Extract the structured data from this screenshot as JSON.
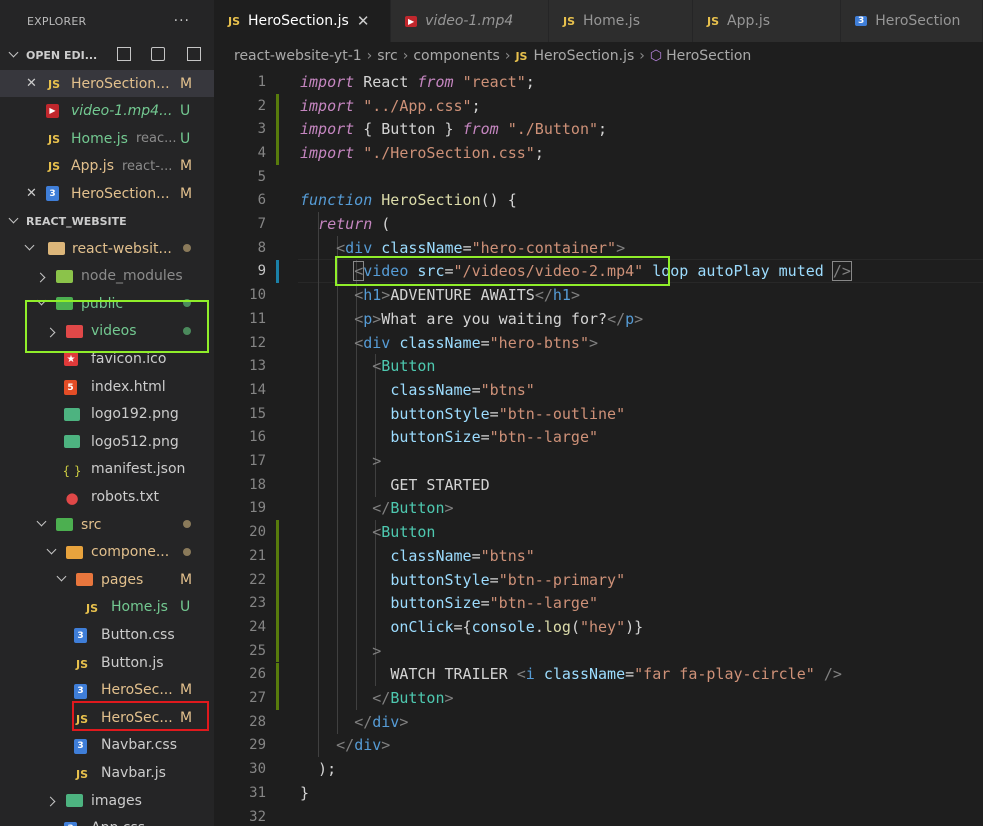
{
  "sidebar": {
    "title": "EXPLORER",
    "more": "···",
    "open_editors_label": "OPEN EDI...",
    "open_editors": [
      {
        "name": "HeroSection...",
        "status": "M",
        "type": "js",
        "close": "✕",
        "selected": true
      },
      {
        "name": "video-1.mp4...",
        "status": "U",
        "type": "video",
        "close": ""
      },
      {
        "name": "Home.js",
        "dim": "reac...",
        "status": "U",
        "type": "js",
        "close": ""
      },
      {
        "name": "App.js",
        "dim": "react-...",
        "status": "M",
        "type": "js",
        "close": ""
      },
      {
        "name": "HeroSection...",
        "status": "M",
        "type": "css",
        "close": "✕"
      }
    ],
    "workspace_label": "REACT_WEBSITE",
    "tree": [
      {
        "name": "react-websit...",
        "type": "folder",
        "depth": 1,
        "open": true,
        "dot": true
      },
      {
        "name": "node_modules",
        "type": "folder-node",
        "depth": 2,
        "open": false,
        "dot": false
      },
      {
        "name": "public",
        "type": "folder-public",
        "depth": 2,
        "open": true,
        "dot": true
      },
      {
        "name": "videos",
        "type": "folder-video",
        "depth": 3,
        "open": false,
        "dot": true
      },
      {
        "name": "favicon.ico",
        "type": "favicon",
        "depth": 3
      },
      {
        "name": "index.html",
        "type": "html",
        "depth": 3
      },
      {
        "name": "logo192.png",
        "type": "image",
        "depth": 3
      },
      {
        "name": "logo512.png",
        "type": "image",
        "depth": 3
      },
      {
        "name": "manifest.json",
        "type": "json",
        "depth": 3
      },
      {
        "name": "robots.txt",
        "type": "robots",
        "depth": 3
      },
      {
        "name": "src",
        "type": "folder-src",
        "depth": 2,
        "open": true,
        "dot": true
      },
      {
        "name": "compone...",
        "type": "folder-comp",
        "depth": 3,
        "open": true,
        "dot": true
      },
      {
        "name": "pages",
        "type": "folder-pages",
        "depth": 4,
        "open": true,
        "status": "M"
      },
      {
        "name": "Home.js",
        "type": "js",
        "depth": 5,
        "status": "U"
      },
      {
        "name": "Button.css",
        "type": "css",
        "depth": 4
      },
      {
        "name": "Button.js",
        "type": "js",
        "depth": 4
      },
      {
        "name": "HeroSec...",
        "type": "css",
        "depth": 4,
        "status": "M"
      },
      {
        "name": "HeroSec...",
        "type": "js",
        "depth": 4,
        "status": "M"
      },
      {
        "name": "Navbar.css",
        "type": "css",
        "depth": 4
      },
      {
        "name": "Navbar.js",
        "type": "js",
        "depth": 4
      },
      {
        "name": "images",
        "type": "folder-images",
        "depth": 3,
        "open": false
      },
      {
        "name": "App.css",
        "type": "css",
        "depth": 3
      }
    ]
  },
  "tabs": [
    {
      "label": "HeroSection.js",
      "type": "js",
      "active": true,
      "close": "✕"
    },
    {
      "label": "video-1.mp4",
      "type": "video",
      "active": false
    },
    {
      "label": "Home.js",
      "type": "js",
      "active": false
    },
    {
      "label": "App.js",
      "type": "js",
      "active": false
    },
    {
      "label": "HeroSection",
      "type": "css",
      "active": false
    }
  ],
  "breadcrumb": [
    "react-website-yt-1",
    "src",
    "components",
    "HeroSection.js",
    "HeroSection"
  ],
  "icons": {
    "js": "JS",
    "css": "3",
    "html": "5",
    "json": "{ }",
    "video": "▶",
    "chevron": "›"
  },
  "editor": {
    "current_line": 9,
    "lines": [
      [
        [
          "kw",
          "import"
        ],
        [
          "txt",
          " React "
        ],
        [
          "kw",
          "from"
        ],
        [
          "txt",
          " "
        ],
        [
          "str",
          "\"react\""
        ],
        [
          "txt",
          ";"
        ]
      ],
      [
        [
          "kw",
          "import"
        ],
        [
          "txt",
          " "
        ],
        [
          "str",
          "\"../App.css\""
        ],
        [
          "txt",
          ";"
        ]
      ],
      [
        [
          "kw",
          "import"
        ],
        [
          "txt",
          " { Button } "
        ],
        [
          "kw",
          "from"
        ],
        [
          "txt",
          " "
        ],
        [
          "str",
          "\"./Button\""
        ],
        [
          "txt",
          ";"
        ]
      ],
      [
        [
          "kw",
          "import"
        ],
        [
          "txt",
          " "
        ],
        [
          "str",
          "\"./HeroSection.css\""
        ],
        [
          "txt",
          ";"
        ]
      ],
      [],
      [
        [
          "kw2",
          "function"
        ],
        [
          "txt",
          " "
        ],
        [
          "fn",
          "HeroSection"
        ],
        [
          "txt",
          "() {"
        ]
      ],
      [
        [
          "txt",
          "  "
        ],
        [
          "kw",
          "return"
        ],
        [
          "txt",
          " ("
        ]
      ],
      [
        [
          "txt",
          "    "
        ],
        [
          "punc",
          "<"
        ],
        [
          "tag",
          "div"
        ],
        [
          "txt",
          " "
        ],
        [
          "attr",
          "className"
        ],
        [
          "txt",
          "="
        ],
        [
          "str",
          "\"hero-container\""
        ],
        [
          "punc",
          ">"
        ]
      ],
      [
        [
          "txt",
          "      "
        ],
        [
          "punc",
          "<"
        ],
        [
          "tag",
          "video"
        ],
        [
          "txt",
          " "
        ],
        [
          "attr",
          "src"
        ],
        [
          "txt",
          "="
        ],
        [
          "str",
          "\"/videos/video-2.mp4\""
        ],
        [
          "txt",
          " "
        ],
        [
          "attr",
          "loop"
        ],
        [
          "txt",
          " "
        ],
        [
          "attr",
          "autoPlay"
        ],
        [
          "txt",
          " "
        ],
        [
          "attr",
          "muted"
        ],
        [
          "txt",
          " "
        ],
        [
          "punc",
          "/>"
        ]
      ],
      [
        [
          "txt",
          "      "
        ],
        [
          "punc",
          "<"
        ],
        [
          "tag",
          "h1"
        ],
        [
          "punc",
          ">"
        ],
        [
          "jsx",
          "ADVENTURE AWAITS"
        ],
        [
          "punc",
          "</"
        ],
        [
          "tag",
          "h1"
        ],
        [
          "punc",
          ">"
        ]
      ],
      [
        [
          "txt",
          "      "
        ],
        [
          "punc",
          "<"
        ],
        [
          "tag",
          "p"
        ],
        [
          "punc",
          ">"
        ],
        [
          "jsx",
          "What are you waiting for?"
        ],
        [
          "punc",
          "</"
        ],
        [
          "tag",
          "p"
        ],
        [
          "punc",
          ">"
        ]
      ],
      [
        [
          "txt",
          "      "
        ],
        [
          "punc",
          "<"
        ],
        [
          "tag",
          "div"
        ],
        [
          "txt",
          " "
        ],
        [
          "attr",
          "className"
        ],
        [
          "txt",
          "="
        ],
        [
          "str",
          "\"hero-btns\""
        ],
        [
          "punc",
          ">"
        ]
      ],
      [
        [
          "txt",
          "        "
        ],
        [
          "punc",
          "<"
        ],
        [
          "comp",
          "Button"
        ]
      ],
      [
        [
          "txt",
          "          "
        ],
        [
          "attr",
          "className"
        ],
        [
          "txt",
          "="
        ],
        [
          "str",
          "\"btns\""
        ]
      ],
      [
        [
          "txt",
          "          "
        ],
        [
          "attr",
          "buttonStyle"
        ],
        [
          "txt",
          "="
        ],
        [
          "str",
          "\"btn--outline\""
        ]
      ],
      [
        [
          "txt",
          "          "
        ],
        [
          "attr",
          "buttonSize"
        ],
        [
          "txt",
          "="
        ],
        [
          "str",
          "\"btn--large\""
        ]
      ],
      [
        [
          "txt",
          "        "
        ],
        [
          "punc",
          ">"
        ]
      ],
      [
        [
          "txt",
          "          "
        ],
        [
          "jsx",
          "GET STARTED"
        ]
      ],
      [
        [
          "txt",
          "        "
        ],
        [
          "punc",
          "</"
        ],
        [
          "comp",
          "Button"
        ],
        [
          "punc",
          ">"
        ]
      ],
      [
        [
          "txt",
          "        "
        ],
        [
          "punc",
          "<"
        ],
        [
          "comp",
          "Button"
        ]
      ],
      [
        [
          "txt",
          "          "
        ],
        [
          "attr",
          "className"
        ],
        [
          "txt",
          "="
        ],
        [
          "str",
          "\"btns\""
        ]
      ],
      [
        [
          "txt",
          "          "
        ],
        [
          "attr",
          "buttonStyle"
        ],
        [
          "txt",
          "="
        ],
        [
          "str",
          "\"btn--primary\""
        ]
      ],
      [
        [
          "txt",
          "          "
        ],
        [
          "attr",
          "buttonSize"
        ],
        [
          "txt",
          "="
        ],
        [
          "str",
          "\"btn--large\""
        ]
      ],
      [
        [
          "txt",
          "          "
        ],
        [
          "attr",
          "onClick"
        ],
        [
          "txt",
          "={"
        ],
        [
          "attr",
          "console"
        ],
        [
          "txt",
          "."
        ],
        [
          "fn",
          "log"
        ],
        [
          "txt",
          "("
        ],
        [
          "str",
          "\"hey\""
        ],
        [
          "txt",
          ")}"
        ]
      ],
      [
        [
          "txt",
          "        "
        ],
        [
          "punc",
          ">"
        ]
      ],
      [
        [
          "txt",
          "          "
        ],
        [
          "jsx",
          "WATCH TRAILER "
        ],
        [
          "punc",
          "<"
        ],
        [
          "tag",
          "i"
        ],
        [
          "txt",
          " "
        ],
        [
          "attr",
          "className"
        ],
        [
          "txt",
          "="
        ],
        [
          "str",
          "\"far fa-play-circle\""
        ],
        [
          "txt",
          " "
        ],
        [
          "punc",
          "/>"
        ]
      ],
      [
        [
          "txt",
          "        "
        ],
        [
          "punc",
          "</"
        ],
        [
          "comp",
          "Button"
        ],
        [
          "punc",
          ">"
        ]
      ],
      [
        [
          "txt",
          "      "
        ],
        [
          "punc",
          "</"
        ],
        [
          "tag",
          "div"
        ],
        [
          "punc",
          ">"
        ]
      ],
      [
        [
          "txt",
          "    "
        ],
        [
          "punc",
          "</"
        ],
        [
          "tag",
          "div"
        ],
        [
          "punc",
          ">"
        ]
      ],
      [
        [
          "txt",
          "  );"
        ]
      ],
      [
        [
          "txt",
          "}"
        ]
      ],
      []
    ],
    "gutter": [
      "",
      "add",
      "add",
      "add",
      "",
      "",
      "",
      "",
      "mod",
      "",
      "",
      "",
      "",
      "",
      "",
      "",
      "",
      "",
      "",
      "add",
      "add",
      "add",
      "add",
      "add",
      "add",
      "add",
      "add",
      "",
      "",
      "",
      "",
      ""
    ]
  },
  "colors": {
    "highlight_green": "#90ee2a",
    "highlight_red": "#e0191d"
  }
}
